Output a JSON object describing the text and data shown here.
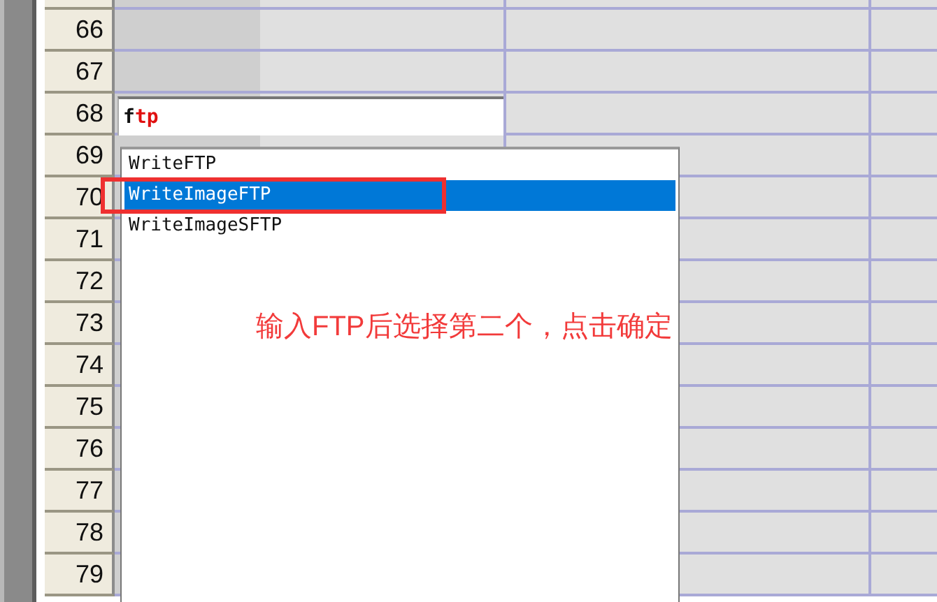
{
  "row_headers": [
    "66",
    "67",
    "68",
    "69",
    "70",
    "71",
    "72",
    "73",
    "74",
    "75",
    "76",
    "77",
    "78",
    "79"
  ],
  "cell_editor": {
    "segments": [
      {
        "text": "f",
        "kind": "typed"
      },
      {
        "text": "tp",
        "kind": "completion"
      }
    ]
  },
  "autocomplete": {
    "items": [
      {
        "label": "WriteFTP",
        "selected": false
      },
      {
        "label": "WriteImageFTP",
        "selected": true
      },
      {
        "label": "WriteImageSFTP",
        "selected": false
      }
    ]
  },
  "annotation": {
    "text": "输入FTP后选择第二个，点击确定"
  }
}
